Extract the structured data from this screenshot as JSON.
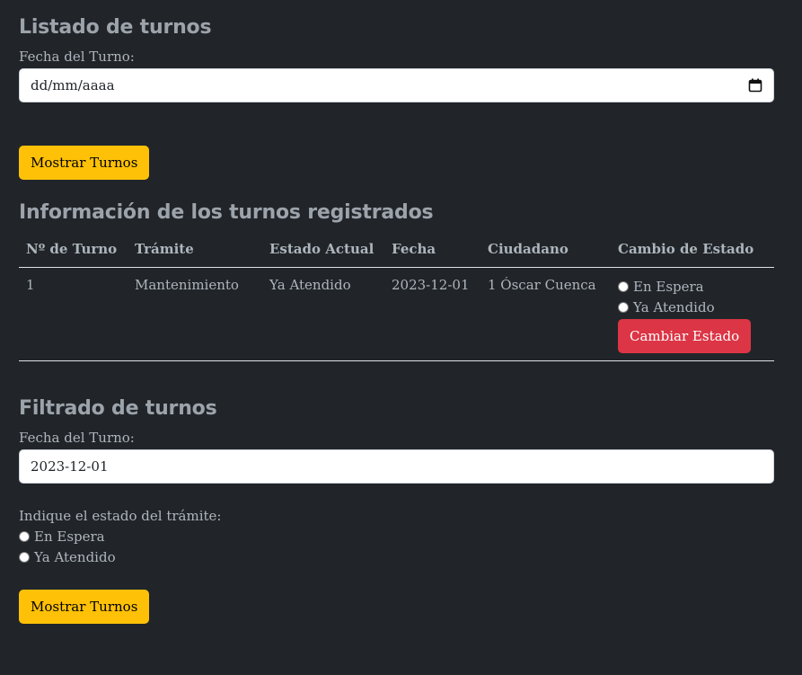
{
  "listado": {
    "title": "Listado de turnos",
    "date_label": "Fecha del Turno:",
    "date_value": "dd/mm/aaaa",
    "button_label": "Mostrar Turnos"
  },
  "info": {
    "title": "Información de los turnos registrados",
    "headers": [
      "Nº de Turno",
      "Trámite",
      "Estado Actual",
      "Fecha",
      "Ciudadano",
      "Cambio de Estado"
    ],
    "rows": [
      {
        "numero": "1",
        "tramite": "Mantenimiento",
        "estado": "Ya Atendido",
        "fecha": "2023-12-01",
        "ciudadano": "1 Óscar Cuenca",
        "opcion_espera": "En Espera",
        "opcion_atendido": "Ya Atendido",
        "button_label": "Cambiar Estado"
      }
    ]
  },
  "filtrado": {
    "title": "Filtrado de turnos",
    "date_label": "Fecha del Turno:",
    "date_value": "2023-12-01",
    "estado_label": "Indique el estado del trámite:",
    "opcion_espera": "En Espera",
    "opcion_atendido": "Ya Atendido",
    "button_label": "Mostrar Turnos"
  },
  "colors": {
    "background": "#212529",
    "accent_yellow": "#ffc107",
    "accent_red": "#dc3545"
  }
}
